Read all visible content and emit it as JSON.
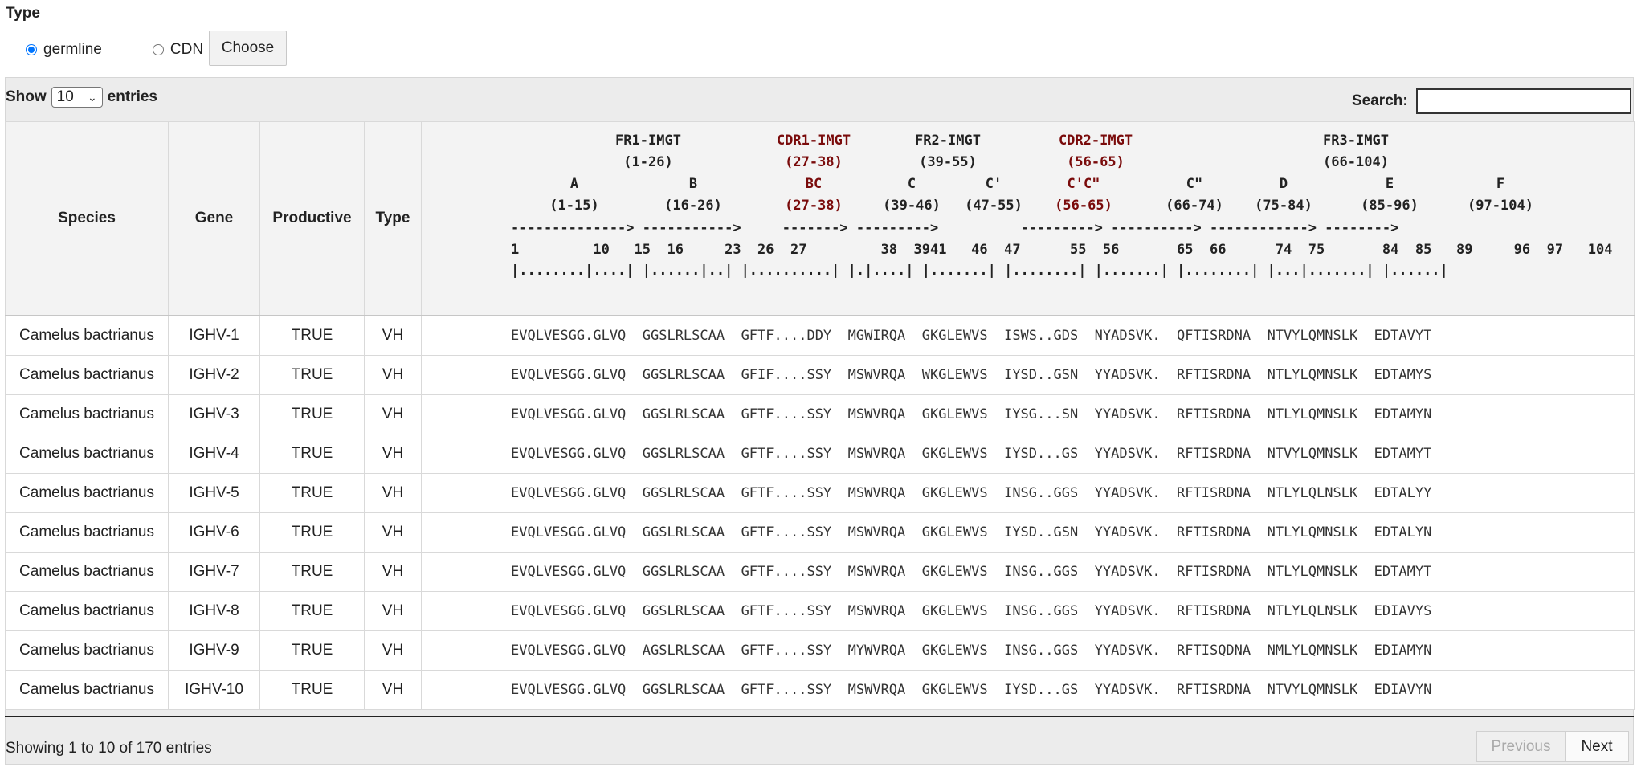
{
  "type_section": {
    "heading": "Type",
    "options": [
      {
        "label": "germline",
        "checked": true
      },
      {
        "label": "CDN",
        "checked": false
      }
    ],
    "choose_label": "Choose"
  },
  "controls": {
    "show_label": "Show",
    "page_size": "10",
    "entries_label": "entries",
    "search_label": "Search:",
    "search_value": ""
  },
  "table": {
    "columns": [
      "Species",
      "Gene",
      "Productive",
      "Type"
    ],
    "sequence_header": {
      "regions": [
        {
          "name": "FR1-IMGT",
          "range": "(1-26)",
          "cdr": false
        },
        {
          "name": "CDR1-IMGT",
          "range": "(27-38)",
          "cdr": true
        },
        {
          "name": "FR2-IMGT",
          "range": "(39-55)",
          "cdr": false
        },
        {
          "name": "CDR2-IMGT",
          "range": "(56-65)",
          "cdr": true
        },
        {
          "name": "FR3-IMGT",
          "range": "(66-104)",
          "cdr": false
        }
      ],
      "strands": [
        {
          "name": "A",
          "range": "(1-15)",
          "cdr": false
        },
        {
          "name": "B",
          "range": "(16-26)",
          "cdr": false
        },
        {
          "name": "BC",
          "range": "(27-38)",
          "cdr": true
        },
        {
          "name": "C",
          "range": "(39-46)",
          "cdr": false
        },
        {
          "name": "C'",
          "range": "(47-55)",
          "cdr": false
        },
        {
          "name": "C'C\"",
          "range": "(56-65)",
          "cdr": true
        },
        {
          "name": "C\"",
          "range": "(66-74)",
          "cdr": false
        },
        {
          "name": "D",
          "range": "(75-84)",
          "cdr": false
        },
        {
          "name": "E",
          "range": "(85-96)",
          "cdr": false
        },
        {
          "name": "F",
          "range": "(97-104)",
          "cdr": false
        }
      ],
      "arrow_line": "--------------> ----------->     -------> --------->          ---------> ----------> ------------> -------->",
      "number_line": "1         10   15  16     23  26  27         38  3941   46  47      55  56       65  66      74  75       84  85   89     96  97   104",
      "dot_line": "|........|....| |......|..| |..........| |.|....| |.......| |........| |.......| |........| |...|.......| |......|"
    },
    "rows": [
      {
        "species": "Camelus bactrianus",
        "gene": "IGHV-1",
        "productive": "TRUE",
        "type": "VH",
        "sequence": "EVQLVESGG.GLVQ  GGSLRLSCAA  GFTF....DDY  MGWIRQA  GKGLEWVS  ISWS..GDS  NYADSVK.  QFTISRDNA  NTVYLQMNSLK  EDTAVYT"
      },
      {
        "species": "Camelus bactrianus",
        "gene": "IGHV-2",
        "productive": "TRUE",
        "type": "VH",
        "sequence": "EVQLVESGG.GLVQ  GGSLRLSCAA  GFIF....SSY  MSWVRQA  WKGLEWVS  IYSD..GSN  YYADSVK.  RFTISRDNA  NTLYLQMNSLK  EDTAMYS"
      },
      {
        "species": "Camelus bactrianus",
        "gene": "IGHV-3",
        "productive": "TRUE",
        "type": "VH",
        "sequence": "EVQLVESGG.GLVQ  GGSLRLSCAA  GFTF....SSY  MSWVRQA  GKGLEWVS  IYSG...SN  YYADSVK.  RFTISRDNA  NTLYLQMNSLK  EDTAMYN"
      },
      {
        "species": "Camelus bactrianus",
        "gene": "IGHV-4",
        "productive": "TRUE",
        "type": "VH",
        "sequence": "EVQLVESGG.GLVQ  GGSLRLSCAA  GFTF....SSY  MSWVRQA  GKGLEWVS  IYSD...GS  YYADSVK.  RFTISRDNA  NTVYLQMNSLK  EDTAMYT"
      },
      {
        "species": "Camelus bactrianus",
        "gene": "IGHV-5",
        "productive": "TRUE",
        "type": "VH",
        "sequence": "EVQLVESGG.GLVQ  GGSLRLSCAA  GFTF....SSY  MSWVRQA  GKGLEWVS  INSG..GGS  YYADSVK.  RFTISRDNA  NTLYLQLNSLK  EDTALYY"
      },
      {
        "species": "Camelus bactrianus",
        "gene": "IGHV-6",
        "productive": "TRUE",
        "type": "VH",
        "sequence": "EVQLVESGG.GLVQ  GGSLRLSCAA  GFTF....SSY  MSWVRQA  GKGLEWVS  IYSD..GSN  YYADSVK.  RFTISRDNA  NTLYLQMNSLK  EDTALYN"
      },
      {
        "species": "Camelus bactrianus",
        "gene": "IGHV-7",
        "productive": "TRUE",
        "type": "VH",
        "sequence": "EVQLVESGG.GLVQ  GGSLRLSCAA  GFTF....SSY  MSWVRQA  GKGLEWVS  INSG..GGS  YYADSVK.  RFTISRDNA  NTLYLQMNSLK  EDTAMYT"
      },
      {
        "species": "Camelus bactrianus",
        "gene": "IGHV-8",
        "productive": "TRUE",
        "type": "VH",
        "sequence": "EVQLVESGG.GLVQ  GGSLRLSCAA  GFTF....SSY  MSWVRQA  GKGLEWVS  INSG..GGS  YYADSVK.  RFTISRDNA  NTLYLQLNSLK  EDIAVYS"
      },
      {
        "species": "Camelus bactrianus",
        "gene": "IGHV-9",
        "productive": "TRUE",
        "type": "VH",
        "sequence": "EVQLVESGG.GLVQ  AGSLRLSCAA  GFTF....SSY  MYWVRQA  GKGLEWVS  INSG..GGS  YYADSVK.  RFTISQDNA  NMLYLQMNSLK  EDIAMYN"
      },
      {
        "species": "Camelus bactrianus",
        "gene": "IGHV-10",
        "productive": "TRUE",
        "type": "VH",
        "sequence": "EVQLVESGG.GLVQ  GGSLRLSCAA  GFTF....SSY  MSWVRQA  GKGLEWVS  IYSD...GS  YYADSVK.  RFTISRDNA  NTVYLQMNSLK  EDIAVYN"
      }
    ]
  },
  "footer": {
    "info": "Showing 1 to 10 of 170 entries",
    "previous_label": "Previous",
    "next_label": "Next"
  }
}
